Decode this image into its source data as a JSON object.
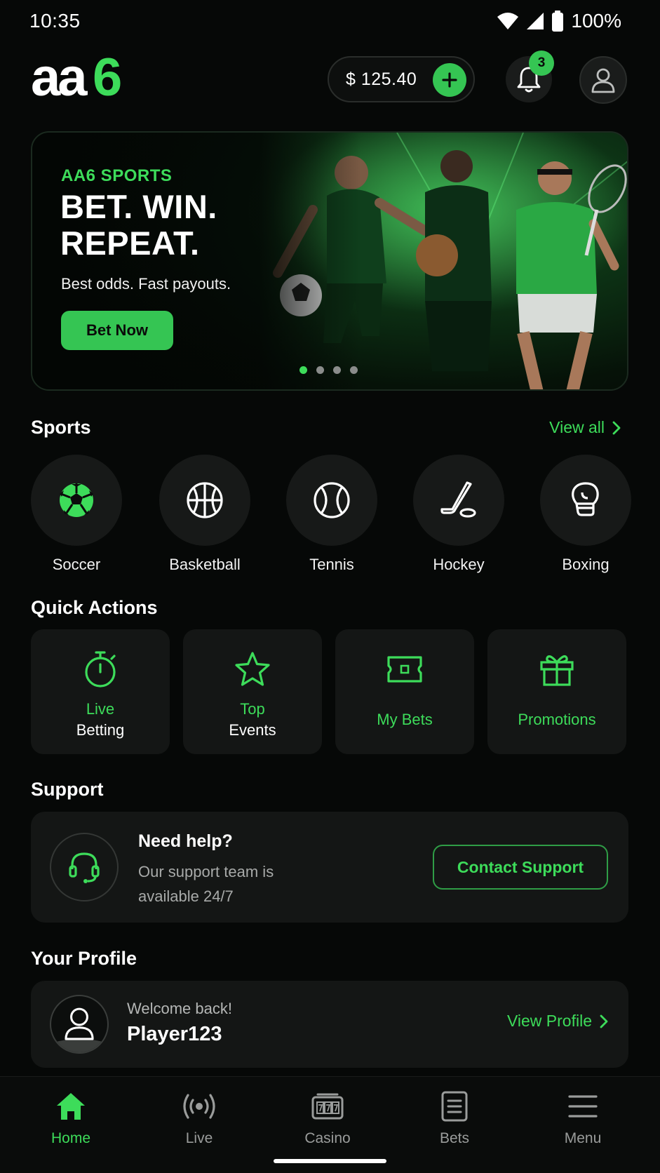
{
  "status_bar": {
    "time": "10:35",
    "battery": "100%",
    "icons": [
      "wifi-icon",
      "signal-icon",
      "battery-icon"
    ]
  },
  "header": {
    "logo_text": "aa6",
    "balance": "$ 125.40",
    "notification_count": "3"
  },
  "banner": {
    "eyebrow": "AA6 SPORTS",
    "title_line1": "BET. WIN.",
    "title_line2": "REPEAT.",
    "subtitle": "Best odds. Fast payouts.",
    "cta": "Bet Now",
    "slide_count": 4,
    "active_slide": 1
  },
  "sports": {
    "title": "Sports",
    "view_all": "View all",
    "items": [
      {
        "label": "Soccer",
        "icon": "soccer-ball-icon"
      },
      {
        "label": "Basketball",
        "icon": "basketball-icon"
      },
      {
        "label": "Tennis",
        "icon": "tennis-ball-icon"
      },
      {
        "label": "Hockey",
        "icon": "hockey-stick-icon"
      },
      {
        "label": "Boxing",
        "icon": "boxing-glove-icon"
      }
    ]
  },
  "quick_actions": {
    "title": "Quick Actions",
    "items": [
      {
        "line1": "Live",
        "line2": "Betting",
        "icon": "stopwatch-icon"
      },
      {
        "line1": "Top",
        "line2": "Events",
        "icon": "star-icon"
      },
      {
        "line1": "My Bets",
        "line2": "",
        "icon": "ticket-icon"
      },
      {
        "line1": "Promotions",
        "line2": "",
        "icon": "gift-icon"
      }
    ]
  },
  "support": {
    "title": "Support",
    "heading": "Need help?",
    "subtitle": "Our support team is available 24/7",
    "cta": "Contact Support"
  },
  "profile": {
    "title": "Your Profile",
    "welcome": "Welcome back!",
    "username": "Player123",
    "cta": "View Profile"
  },
  "bottom_nav": {
    "items": [
      {
        "label": "Home",
        "icon": "home-icon",
        "active": true
      },
      {
        "label": "Live",
        "icon": "broadcast-icon",
        "active": false
      },
      {
        "label": "Casino",
        "icon": "slot-machine-icon",
        "active": false
      },
      {
        "label": "Bets",
        "icon": "bet-slip-icon",
        "active": false
      },
      {
        "label": "Menu",
        "icon": "hamburger-menu-icon",
        "active": false
      }
    ]
  },
  "colors": {
    "accent": "#3ddc5a",
    "background": "#060807",
    "card": "#141615"
  }
}
